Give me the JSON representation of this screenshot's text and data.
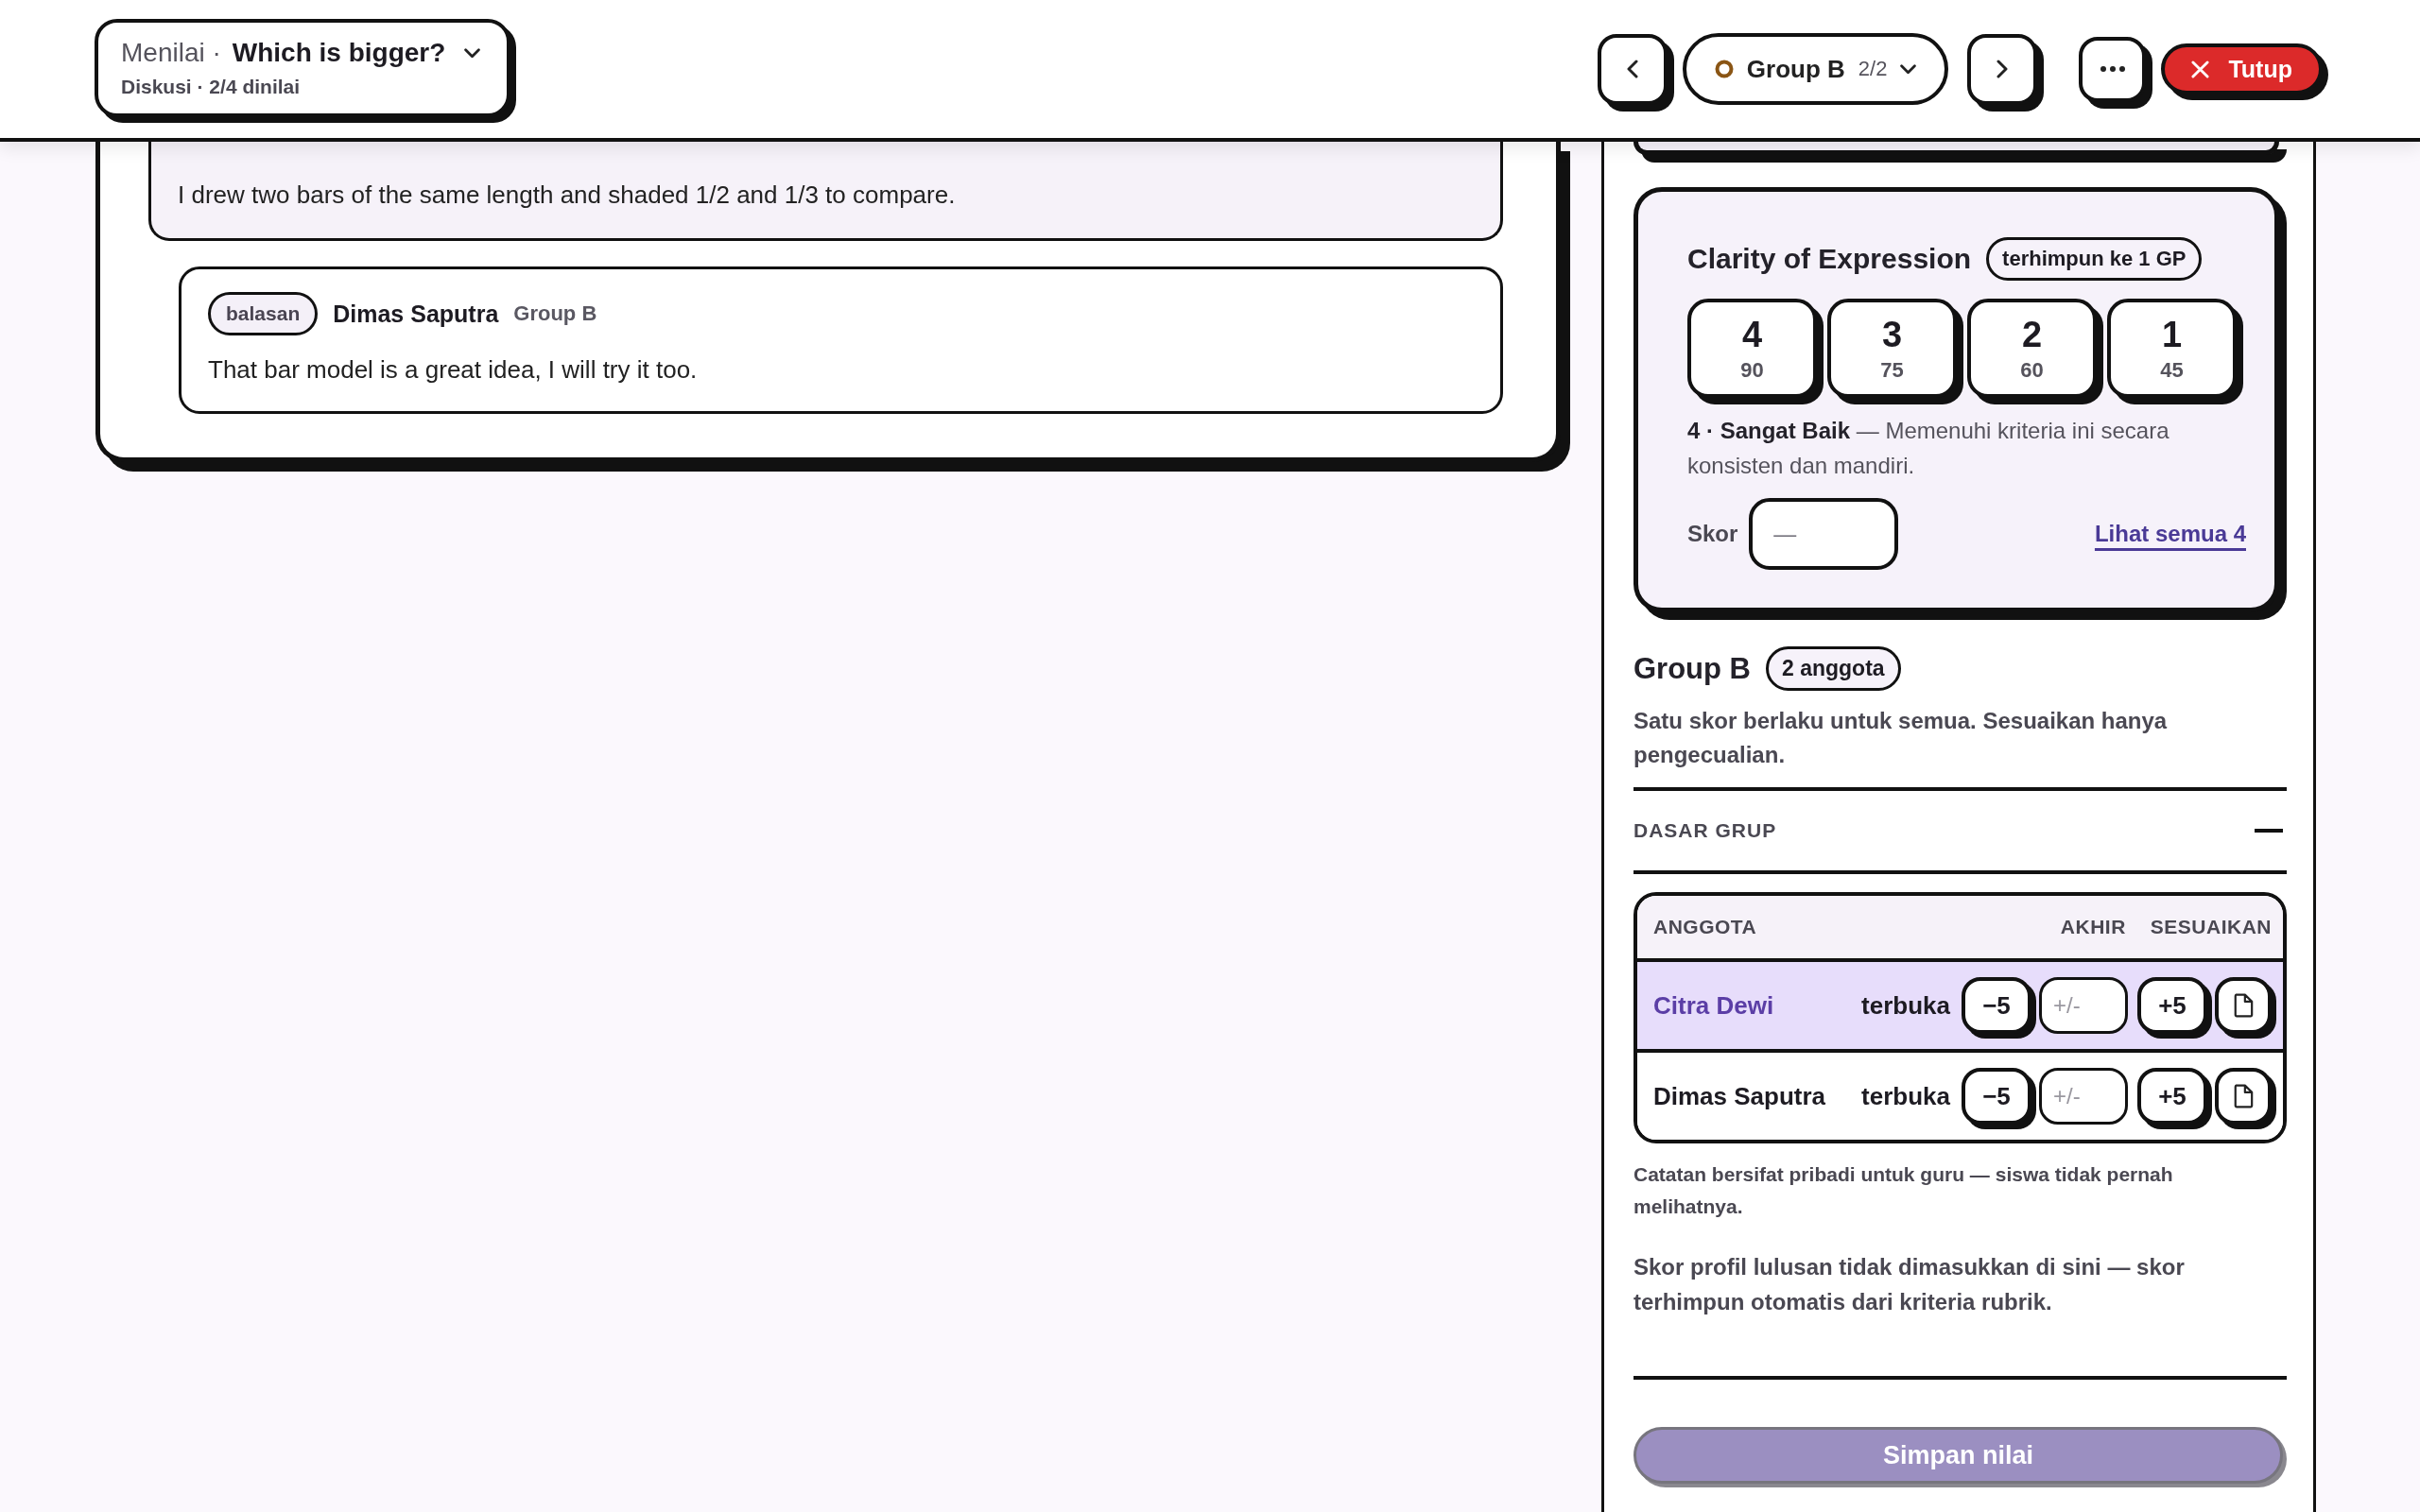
{
  "header": {
    "assignment": {
      "prefix": "Menilai ·",
      "title": "Which is bigger?",
      "subtitle": "Diskusi · 2/4 dinilai"
    },
    "group_selector": {
      "label": "Group B",
      "count": "2/2"
    },
    "close_button": {
      "label": "Tutup"
    }
  },
  "posts": [
    {
      "kind": "post",
      "body": "I drew two bars of the same length and shaded 1/2 and 1/3 to compare."
    },
    {
      "kind": "reply",
      "badge": "balasan",
      "author": "Dimas Saputra",
      "group": "Group B",
      "body": "That bar model is a great idea, I will try it too."
    }
  ],
  "criterion": {
    "title": "Clarity of Expression",
    "badge": "terhimpun ke 1 GP",
    "levels": [
      {
        "score": "4",
        "points": "90",
        "selected": false
      },
      {
        "score": "3",
        "points": "75",
        "selected": false
      },
      {
        "score": "2",
        "points": "60",
        "selected": false
      },
      {
        "score": "1",
        "points": "45",
        "selected": false
      }
    ],
    "description": "**4 · Sangat Baik** — Memenuhi kriteria ini secara konsisten dan mandiri.",
    "score_label": "Skor",
    "score_placeholder": "—",
    "link": "Lihat semua 4"
  },
  "group": {
    "title": "Group B",
    "badge": "2 anggota",
    "description": "Satu skor berlaku untuk semua. Sesuaikan hanya pengecualian.",
    "section": {
      "label": "DASAR GRUP",
      "expanded": true
    },
    "table": {
      "columns": [
        "ANGGOTA",
        "AKHIR",
        "SESUAIKAN"
      ],
      "rows": [
        {
          "name": "Citra Dewi",
          "status": "terbuka",
          "selected": true,
          "decrease": "−5",
          "adjust_placeholder": "+/-",
          "increase": "+5"
        },
        {
          "name": "Dimas Saputra",
          "status": "terbuka",
          "selected": false,
          "decrease": "−5",
          "adjust_placeholder": "+/-",
          "increase": "+5"
        }
      ]
    },
    "private_note": "Catatan bersifat pribadi untuk guru — siswa tidak pernah melihatnya.",
    "profile_note": "Skor profil lulusan tidak dimasukkan di sini — skor terhimpun otomatis dari kriteria rubrik."
  },
  "save_button": {
    "label": "Simpan nilai",
    "disabled": true
  }
}
